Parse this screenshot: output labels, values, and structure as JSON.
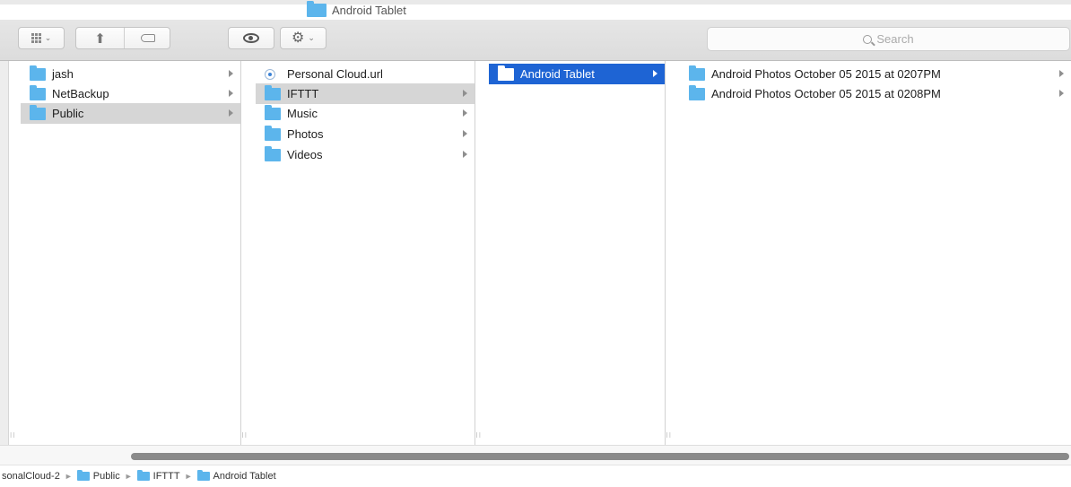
{
  "window": {
    "title": "Android Tablet"
  },
  "toolbar": {
    "view_button_icon": "grid-view-icon",
    "share_icon": "share-icon",
    "tag_icon": "tag-icon",
    "quicklook_icon": "eye-icon",
    "action_icon": "gear-icon",
    "search_placeholder": "Search"
  },
  "columns": [
    {
      "items": [
        {
          "label": "jash",
          "icon": "folder-icon",
          "has_children": true,
          "selected": false
        },
        {
          "label": "NetBackup",
          "icon": "folder-icon",
          "has_children": true,
          "selected": false
        },
        {
          "label": "Public",
          "icon": "folder-icon",
          "has_children": true,
          "selected": true
        }
      ]
    },
    {
      "items": [
        {
          "label": "Personal Cloud.url",
          "icon": "url-file-icon",
          "has_children": false,
          "selected": false
        },
        {
          "label": "IFTTT",
          "icon": "folder-icon",
          "has_children": true,
          "selected": true
        },
        {
          "label": "Music",
          "icon": "folder-icon",
          "has_children": true,
          "selected": false
        },
        {
          "label": "Photos",
          "icon": "folder-icon",
          "has_children": true,
          "selected": false
        },
        {
          "label": "Videos",
          "icon": "folder-icon",
          "has_children": true,
          "selected": false
        }
      ]
    },
    {
      "items": [
        {
          "label": "Android Tablet",
          "icon": "folder-icon",
          "has_children": true,
          "selected": true,
          "active": true
        }
      ]
    },
    {
      "items": [
        {
          "label": "Android Photos October 05 2015 at 0207PM",
          "icon": "folder-icon",
          "has_children": true,
          "selected": false
        },
        {
          "label": "Android Photos October 05 2015 at 0208PM",
          "icon": "folder-icon",
          "has_children": true,
          "selected": false
        }
      ]
    }
  ],
  "pathbar": {
    "items": [
      "sonalCloud-2",
      "Public",
      "IFTTT",
      "Android Tablet"
    ]
  },
  "colors": {
    "selection_active": "#1e64d4",
    "selection_inactive": "#d6d6d6",
    "folder": "#5cb5ec"
  }
}
